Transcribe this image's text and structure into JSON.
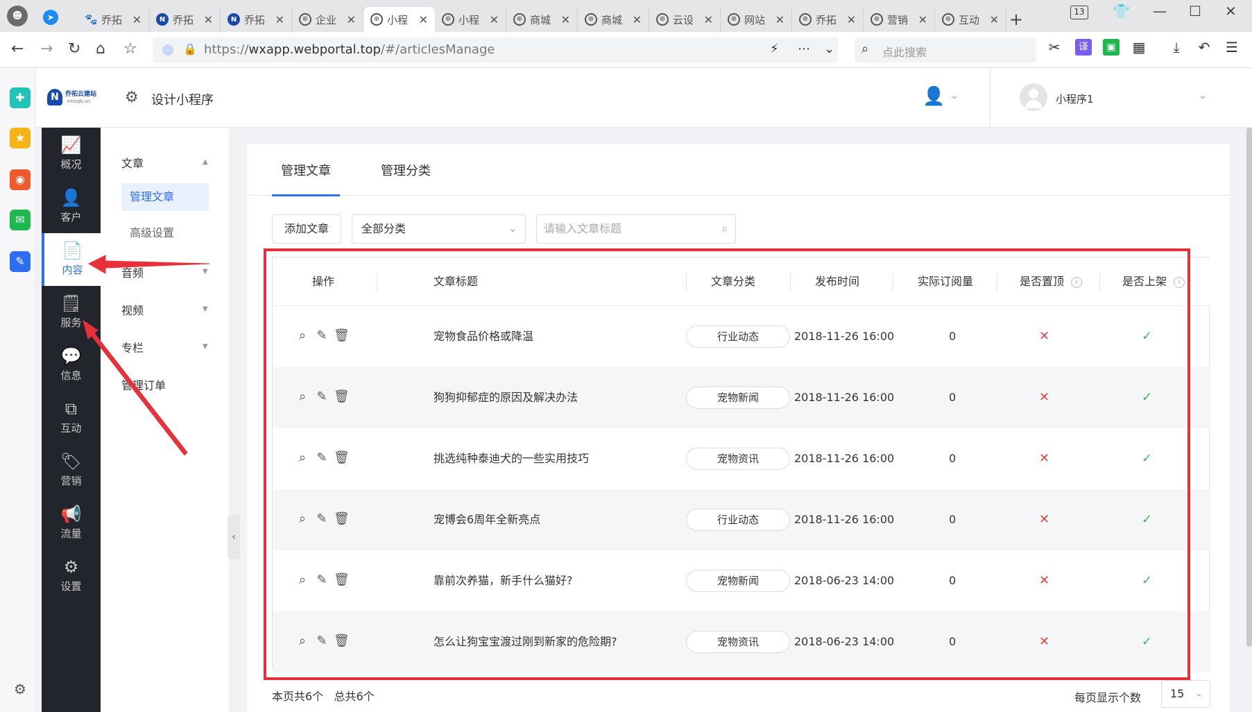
{
  "browser": {
    "tabs": [
      {
        "label": "乔拓",
        "icon": "paw-icon"
      },
      {
        "label": "乔拓",
        "icon": "n-logo-icon"
      },
      {
        "label": "乔拓",
        "icon": "n-logo-icon"
      },
      {
        "label": "企业",
        "icon": "globe-icon"
      },
      {
        "label": "小程",
        "icon": "globe-icon",
        "active": true
      },
      {
        "label": "小程",
        "icon": "globe-icon"
      },
      {
        "label": "商城",
        "icon": "globe-icon"
      },
      {
        "label": "商城",
        "icon": "globe-icon"
      },
      {
        "label": "云设",
        "icon": "globe-icon"
      },
      {
        "label": "网站",
        "icon": "globe-icon"
      },
      {
        "label": "乔拓",
        "icon": "globe-icon"
      },
      {
        "label": "营销",
        "icon": "globe-icon"
      },
      {
        "label": "互动",
        "icon": "globe-icon"
      }
    ],
    "tab_count": "13",
    "url_prefix": "https://",
    "url_main": "wxapp.webportal.top",
    "url_rest": "/#/articlesManage",
    "search_placeholder": "点此搜索"
  },
  "app": {
    "logo_name": "乔拓云建站",
    "logo_sub": "xmsqb.cn",
    "design_label": "设计小程序",
    "mini_program_name": "小程序1"
  },
  "side_nav": [
    {
      "label": "概况",
      "icon": "chart-icon"
    },
    {
      "label": "客户",
      "icon": "user-icon"
    },
    {
      "label": "内容",
      "icon": "document-icon",
      "active": true
    },
    {
      "label": "服务",
      "icon": "service-icon"
    },
    {
      "label": "信息",
      "icon": "message-icon"
    },
    {
      "label": "互动",
      "icon": "interact-icon"
    },
    {
      "label": "营销",
      "icon": "tag-icon"
    },
    {
      "label": "流量",
      "icon": "megaphone-icon"
    },
    {
      "label": "设置",
      "icon": "settings-icon"
    }
  ],
  "sub_nav": {
    "group_article": "文章",
    "item_manage": "管理文章",
    "item_advanced": "高级设置",
    "group_audio": "音频",
    "group_video": "视频",
    "group_column": "专栏",
    "item_orders": "管理订单"
  },
  "panel": {
    "tab_manage": "管理文章",
    "tab_category": "管理分类",
    "add_button": "添加文章",
    "category_select": "全部分类",
    "title_placeholder": "请输入文章标题",
    "columns": {
      "ops": "操作",
      "title": "文章标题",
      "category": "文章分类",
      "time": "发布时间",
      "reads": "实际订阅量",
      "pinned": "是否置顶",
      "published": "是否上架"
    },
    "rows": [
      {
        "title": "宠物食品价格或降温",
        "category": "行业动态",
        "time": "2018-11-26 16:00",
        "reads": "0",
        "pinned": false,
        "published": true
      },
      {
        "title": "狗狗抑郁症的原因及解决办法",
        "category": "宠物新闻",
        "time": "2018-11-26 16:00",
        "reads": "0",
        "pinned": false,
        "published": true
      },
      {
        "title": "挑选纯种泰迪犬的一些实用技巧",
        "category": "宠物资讯",
        "time": "2018-11-26 16:00",
        "reads": "0",
        "pinned": false,
        "published": true
      },
      {
        "title": "宠博会6周年全新亮点",
        "category": "行业动态",
        "time": "2018-11-26 16:00",
        "reads": "0",
        "pinned": false,
        "published": true
      },
      {
        "title": "靠前次养猫，新手什么猫好?",
        "category": "宠物新闻",
        "time": "2018-06-23 14:00",
        "reads": "0",
        "pinned": false,
        "published": true
      },
      {
        "title": "怎么让狗宝宝渡过刚到新家的危险期?",
        "category": "宠物资讯",
        "time": "2018-06-23 14:00",
        "reads": "0",
        "pinned": false,
        "published": true
      }
    ],
    "page_count_text": "本页共6个",
    "total_count_text": "总共6个",
    "per_page_label": "每页显示个数",
    "per_page_value": "15"
  },
  "colors": {
    "accent": "#2d6df0",
    "annotation_red": "#e8303a",
    "no_mark": "#e8433d",
    "yes_mark": "#3fb95a",
    "side_dark": "#22252b"
  }
}
